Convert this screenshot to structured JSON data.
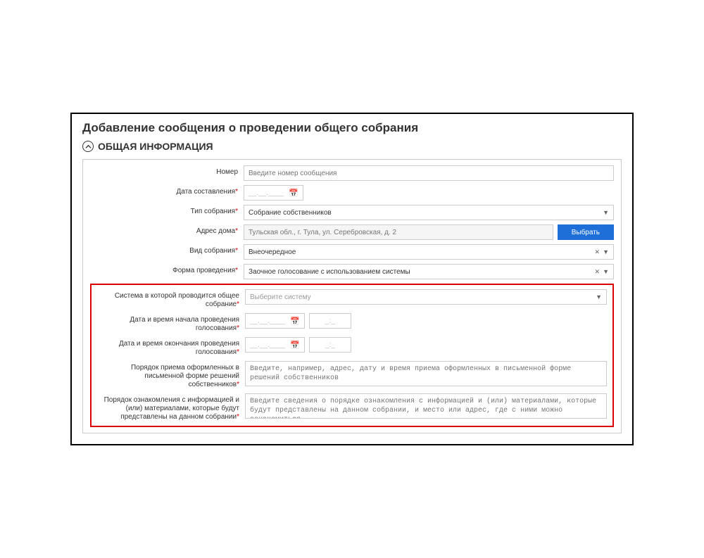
{
  "page_title": "Добавление сообщения о проведении общего собрания",
  "section_title": "ОБЩАЯ ИНФОРМАЦИЯ",
  "labels": {
    "number": "Номер",
    "date_created": "Дата составления",
    "meeting_type": "Тип собрания",
    "house_address": "Адрес дома",
    "meeting_kind": "Вид собрания",
    "meeting_form": "Форма проведения",
    "system": "Система в которой проводится общее собрание",
    "vote_start": "Дата и время начала проведения голосования",
    "vote_end": "Дата и время окончания проведения голосования",
    "written_order": "Порядок приема оформленных в письменной форме решений собственников",
    "info_order": "Порядок ознакомления с информацией и (или) материалами, которые будут представлены на данном собрании"
  },
  "placeholders": {
    "number": "Введите номер сообщения",
    "date": "__.__.____",
    "time": "_:_",
    "house_address": "Тульская обл., г. Тула, ул. Серебровская, д. 2",
    "system": "Выберите систему",
    "written_order": "Введите, например, адрес, дату и время приема оформленных в письменной форме решений собственников",
    "info_order": "Введите сведения о порядке ознакомления с информацией и (или) материалами, которые будут представлены на данном собрании, и место или адрес, где с ними можно ознакомиться"
  },
  "values": {
    "meeting_type": "Собрание собственников",
    "meeting_kind": "Внеочередное",
    "meeting_form": "Заочное голосование с использованием системы"
  },
  "buttons": {
    "select": "Выбрать"
  }
}
